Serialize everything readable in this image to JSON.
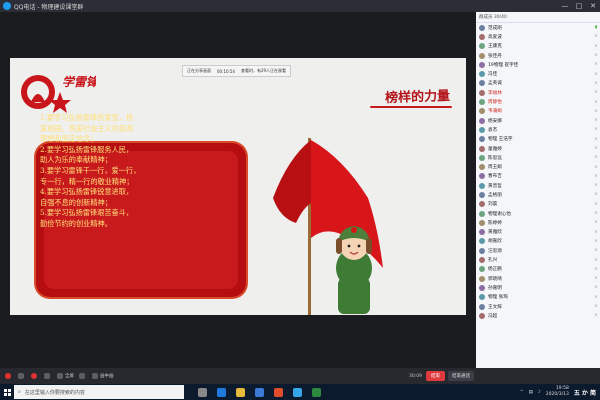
{
  "titlebar": {
    "title": "QQ电话 - 物理建设课堂群",
    "min": "—",
    "max": "□",
    "close": "✕"
  },
  "share_hint": {
    "status": "正在分享画面",
    "time": "00:10:54",
    "note": "查看时，有29人正在观看"
  },
  "slide": {
    "logo_text": "学雷锋",
    "heading": "榜样的力量",
    "body": "1.要学习弘扬雷锋热爱党，热\n爱祖国，热爱社会主义的崇高\n理想和坚定信念；\n2.要学习弘扬雷锋服务人民，\n助人为乐的奉献精神；\n3.要学习雷锋干一行，爱一行，\n专一行，精一行的敬业精神；\n4.要学习弘扬雷锋锐意进取，\n自强不息的创新精神；\n5.要学习弘扬雷锋艰苦奋斗，\n勤俭节约的创业精神。"
  },
  "sidebar": {
    "header": "群成员 30/40",
    "members": [
      {
        "name": "范成刚",
        "red": false,
        "speaker": true
      },
      {
        "name": "高爱波",
        "red": false
      },
      {
        "name": "王康克",
        "red": false
      },
      {
        "name": "张佳丹",
        "red": false
      },
      {
        "name": "19物理 崔宇佳",
        "red": false
      },
      {
        "name": "冯佳",
        "red": false
      },
      {
        "name": "孟英诚",
        "red": false
      },
      {
        "name": "李福林",
        "red": true
      },
      {
        "name": "周静怡",
        "red": true
      },
      {
        "name": "韦蒲娟",
        "red": true
      },
      {
        "name": "杨安娜",
        "red": false
      },
      {
        "name": "袁杰",
        "red": false
      },
      {
        "name": "物理 王浩宇",
        "red": false
      },
      {
        "name": "童雅婷",
        "red": false
      },
      {
        "name": "陈思远",
        "red": false
      },
      {
        "name": "周玉娟",
        "red": false
      },
      {
        "name": "曹布吉",
        "red": false
      },
      {
        "name": "黄晋哲",
        "red": false
      },
      {
        "name": "孟格丽",
        "red": false
      },
      {
        "name": "刘晨",
        "red": false
      },
      {
        "name": "物理谢心怡",
        "red": false
      },
      {
        "name": "陈婷婷",
        "red": false
      },
      {
        "name": "黄雅欣",
        "red": false
      },
      {
        "name": "胡嘉欣",
        "red": false
      },
      {
        "name": "汪思源",
        "red": false
      },
      {
        "name": "孔兴",
        "red": false
      },
      {
        "name": "杨正鹏",
        "red": false
      },
      {
        "name": "郭晓晴",
        "red": false
      },
      {
        "name": "孙嘉明",
        "red": false
      },
      {
        "name": "物理 张琦",
        "red": false
      },
      {
        "name": "王文辉",
        "red": false
      },
      {
        "name": "冯超",
        "red": false
      }
    ]
  },
  "controls": {
    "items": [
      "",
      "",
      "",
      "",
      "全屏",
      "",
      "画中画"
    ],
    "timer": "30:09",
    "end": "结束",
    "quit": "结束通话"
  },
  "taskbar": {
    "search_placeholder": "在这里输入你要搜索的内容",
    "time": "19:58",
    "date": "2020/3/13",
    "ime": "五 か 简"
  },
  "colors": {
    "accent_red": "#c81a1c",
    "text_gold": "#ffe07a",
    "bar": "#27292f"
  }
}
